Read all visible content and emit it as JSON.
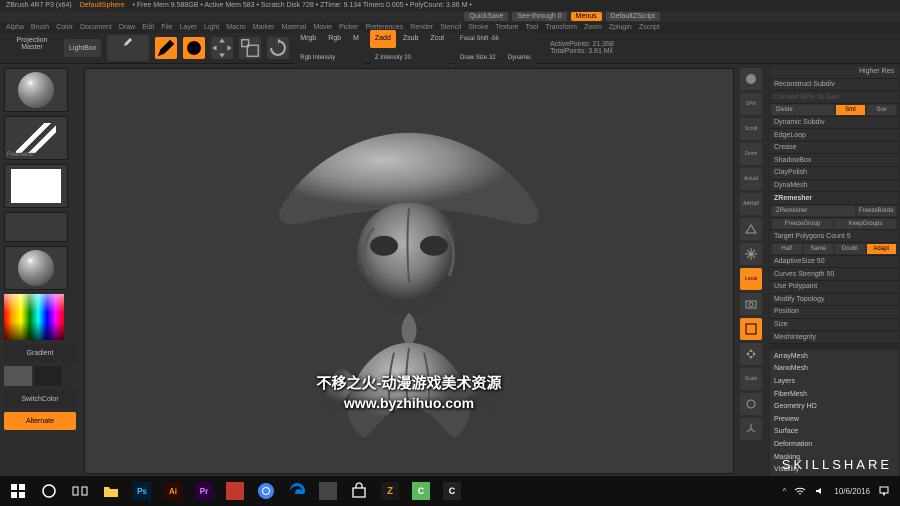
{
  "menubar": [
    "Alpha",
    "Brush",
    "Color",
    "Document",
    "Draw",
    "Edit",
    "File",
    "Layer",
    "Light",
    "Macro",
    "Marker",
    "Material",
    "Movie",
    "Picker",
    "Preferences",
    "Render",
    "Stencil",
    "Stroke",
    "Texture",
    "Tool",
    "Transform",
    "Zoom",
    "Zplugin",
    "Zscript"
  ],
  "titlebar": {
    "app": "ZBrush 4R7 P3 (x64)",
    "doc": "DefaultSphere",
    "stats": "• Free Mem 9.588GB • Active Mem 583 • Scratch Disk 728 • ZTime: 9.134 Timers 0.005 • PolyCount: 3.86 M •"
  },
  "pills": {
    "quicksave": "QuickSave",
    "seethrough": "See-through 0",
    "menus": "Menus",
    "script": "DefaultZScript"
  },
  "toolbar": {
    "projection": "Projection\nMaster",
    "lightbox": "LightBox",
    "quicksketch": "Quick\nSketch",
    "edit": "Edit",
    "draw": "Draw",
    "mrgb": "Mrgb",
    "rgb": "Rgb",
    "m": "M",
    "rgbintensity": "Rgb Intensity",
    "zadd": "Zadd",
    "zsub": "Zsub",
    "zcut": "Zcut",
    "zintensity": "Z Intensity 20",
    "focal": "Focal Shift -56",
    "drawsize": "Draw Size 32",
    "dynamic": "Dynamic",
    "activepoints": "ActivePoints: 21,358",
    "totalpoints": "TotalPoints: 3.81 Mil"
  },
  "leftcol": {
    "material": "Material",
    "brush": "Freehand",
    "alpha": "",
    "gradient": "Gradient",
    "switchcolor": "SwitchColor",
    "alternate": "Alternate"
  },
  "sidetools": [
    "Bird",
    "SPix",
    "Scroll",
    "Zoom",
    "Actual",
    "AAHalf",
    "Persp",
    "Floor",
    "Local",
    "Edit",
    "LCam",
    "Frame",
    "Move",
    "Scale",
    "Rotate",
    "Trans"
  ],
  "rightpanel": {
    "top": [
      "Higher Res",
      "Reconstruct Subdiv",
      "Convert BPR To Geo"
    ],
    "divide": {
      "label": "Divide",
      "smt": "Smt",
      "suv": "Suv"
    },
    "geom": [
      "Dynamic Subdiv",
      "EdgeLoop",
      "Crease",
      "ShadowBox",
      "ClayPolish",
      "DynaMesh"
    ],
    "zrem": {
      "header": "ZRemesher",
      "items": [
        "ZRemesher",
        "FreezeBorde",
        "FreezeGroup",
        "KeepGroups"
      ],
      "target": "Target Polygons Count 5",
      "half": "Half",
      "same": "Same",
      "double": "Doubl",
      "adapt": "Adapt",
      "adaptive": "AdaptiveSize 50",
      "curves": "Curves Strength 50",
      "polypaint": "Use Polypaint"
    },
    "more": [
      "Modify Topology",
      "Position",
      "Size",
      "MeshIntegrity"
    ],
    "sections": [
      "ArrayMesh",
      "NanoMesh",
      "Layers",
      "FiberMesh",
      "Geometry HD",
      "Preview",
      "Surface",
      "Deformation",
      "Masking",
      "Visibility"
    ]
  },
  "watermark": {
    "line1": "不移之火-动漫游戏美术资源",
    "line2": "www.byzhihuo.com"
  },
  "skillshare": "SKILLSHARE",
  "taskbar": {
    "date": "10/6/2016"
  }
}
